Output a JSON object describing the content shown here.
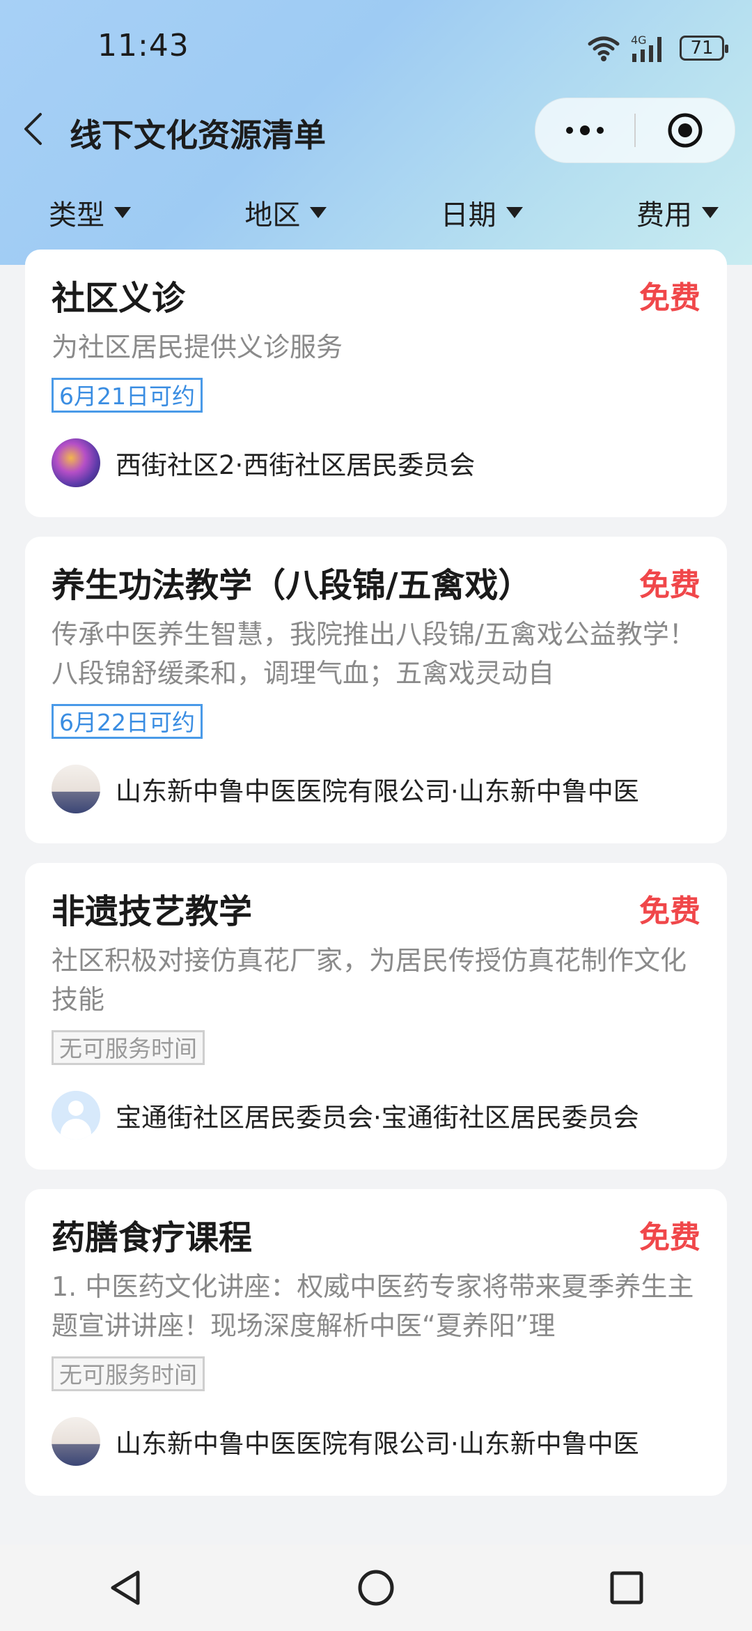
{
  "status_bar": {
    "time": "11:43",
    "network": "4G",
    "battery": "71"
  },
  "nav": {
    "title": "线下文化资源清单"
  },
  "filters": [
    {
      "label": "类型"
    },
    {
      "label": "地区"
    },
    {
      "label": "日期"
    },
    {
      "label": "费用"
    }
  ],
  "cards": [
    {
      "title": "社区义诊",
      "price": "免费",
      "description": "为社区居民提供义诊服务",
      "tag": "6月21日可约",
      "organization": "西街社区2·西街社区居民委员会"
    },
    {
      "title": "养生功法教学（八段锦/五禽戏）",
      "price": "免费",
      "description": "传承中医养生智慧，我院推出八段锦/五禽戏公益教学！八段锦舒缓柔和，调理气血；五禽戏灵动自",
      "tag": "6月22日可约",
      "organization": "山东新中鲁中医医院有限公司·山东新中鲁中医"
    },
    {
      "title": "非遗技艺教学",
      "price": "免费",
      "description": "社区积极对接仿真花厂家，为居民传授仿真花制作文化技能",
      "tag": "无可服务时间",
      "organization": "宝通街社区居民委员会·宝通街社区居民委员会"
    },
    {
      "title": "药膳食疗课程",
      "price": "免费",
      "description": "1. 中医药文化讲座：权威中医药专家将带来夏季养生主题宣讲讲座！现场深度解析中医“夏养阳”理",
      "tag": "无可服务时间",
      "organization": "山东新中鲁中医医院有限公司·山东新中鲁中医"
    }
  ],
  "icons": {
    "back": "chevron-left-icon",
    "more": "more-dots-icon",
    "target": "target-icon",
    "wifi": "wifi-icon",
    "signal": "signal-icon",
    "nav_back": "triangle-back-icon",
    "nav_home": "circle-home-icon",
    "nav_recent": "square-recent-icon"
  },
  "colors": {
    "price": "#f0474a",
    "tag_available": "#3a8de2",
    "tag_none": "#9a9a9a"
  }
}
